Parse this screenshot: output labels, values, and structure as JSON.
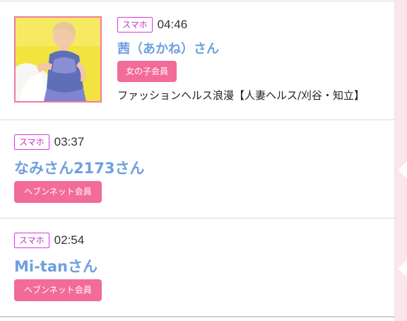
{
  "colors": {
    "name_blue": "#6e9fe0",
    "badge_pink": "#f26b9a",
    "device_magenta": "#d43bd8",
    "side_stripe": "#fde6ea"
  },
  "entries": [
    {
      "device": "スマホ",
      "time": "04:46",
      "name": "茜（あかね）さん",
      "member_type": "女の子会員",
      "shop": "ファッションヘルス浪漫【人妻ヘルス/刈谷・知立】",
      "avatar": "profile-photo"
    },
    {
      "device": "スマホ",
      "time": "03:37",
      "name": "なみさん2173さん",
      "member_type": "ヘブンネット会員"
    },
    {
      "device": "スマホ",
      "time": "02:54",
      "name": "Mi-tanさん",
      "member_type": "ヘブンネット会員"
    }
  ]
}
